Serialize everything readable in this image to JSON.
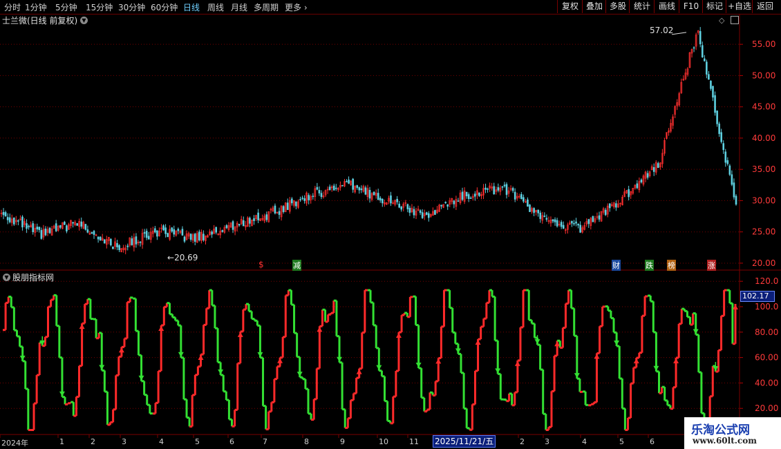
{
  "toolbar": {
    "periods": [
      "分时",
      "1分钟",
      "5分钟",
      "15分钟",
      "30分钟",
      "60分钟",
      "日线",
      "周线",
      "月线",
      "多周期",
      "更多"
    ],
    "active_period": "日线",
    "right_buttons": [
      "复权",
      "叠加",
      "多股",
      "统计",
      "画线",
      "F10",
      "标记",
      "+自选",
      "返回"
    ]
  },
  "main": {
    "title": "士兰微(日线 前复权)",
    "high_label": "57.02",
    "low_label": "20.69",
    "markers": [
      {
        "text": "$",
        "color": "#ff3030"
      },
      {
        "text": "减",
        "color": "#ffffff",
        "bg": "#1f7a1f"
      },
      {
        "text": "财",
        "color": "#ffffff",
        "bg": "#1b4aa0"
      },
      {
        "text": "跌",
        "color": "#ffffff",
        "bg": "#1f7a1f"
      },
      {
        "text": "榜",
        "color": "#ffffff",
        "bg": "#b06010"
      },
      {
        "text": "涨",
        "color": "#ffffff",
        "bg": "#b02020"
      }
    ],
    "price_axis": [
      "55.00",
      "50.00",
      "45.00",
      "40.00",
      "35.00",
      "30.00",
      "25.00",
      "20.00"
    ]
  },
  "indicator": {
    "title": "股朋指标网",
    "current_value": "102.17",
    "axis": [
      "120.0",
      "100.0",
      "80.00",
      "60.00",
      "40.00",
      "20.00"
    ]
  },
  "time_axis": {
    "labels": [
      "2024年",
      "1",
      "2",
      "3",
      "4",
      "5",
      "6",
      "7",
      "8",
      "9",
      "10",
      "11",
      "2",
      "3",
      "4",
      "5",
      "6"
    ],
    "cursor_date": "2025/11/21/五"
  },
  "watermark": {
    "line1": "乐淘公式网",
    "line2": "www.60lt.com"
  },
  "colors": {
    "up": "#ff2a2a",
    "down": "#33e033",
    "grid": "#7a0000",
    "accent": "#6fd0ff"
  },
  "chart_data": {
    "type": "line",
    "title": "士兰微(日线 前复权)",
    "x_range": [
      "2024-01",
      "2025-06"
    ],
    "price_ylim": [
      19,
      58
    ],
    "price_series_approx": [
      {
        "month": "2024-01",
        "close": 28
      },
      {
        "month": "2024-02",
        "close": 24.5
      },
      {
        "month": "2024-03",
        "close": 26.5
      },
      {
        "month": "2024-04",
        "close": 22.5
      },
      {
        "month": "2024-05",
        "close": 25
      },
      {
        "month": "2024-06",
        "close": 24
      },
      {
        "month": "2024-07",
        "close": 26
      },
      {
        "month": "2024-08",
        "close": 28
      },
      {
        "month": "2024-09",
        "close": 31
      },
      {
        "month": "2024-10",
        "close": 32.5
      },
      {
        "month": "2024-11",
        "close": 30
      },
      {
        "month": "2024-12",
        "close": 27.5
      },
      {
        "month": "2025-01",
        "close": 31
      },
      {
        "month": "2025-02",
        "close": 32
      },
      {
        "month": "2025-03",
        "close": 27
      },
      {
        "month": "2025-04",
        "close": 25.5
      },
      {
        "month": "2025-05",
        "close": 30
      },
      {
        "month": "2025-06",
        "close": 36
      },
      {
        "month": "2025-07",
        "close": 57.02
      },
      {
        "month": "2025-08",
        "close": 29
      }
    ],
    "high": 57.02,
    "low": 20.69,
    "indicator_ylim": [
      0,
      125
    ],
    "indicator_last": 102.17
  }
}
